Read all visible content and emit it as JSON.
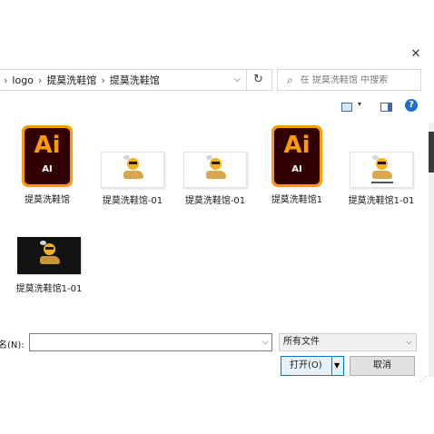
{
  "window": {
    "close_glyph": "✕"
  },
  "address": {
    "crumbs": [
      "logo",
      "提莫洗鞋馆",
      "提莫洗鞋馆"
    ],
    "separator": "›",
    "dropdown_glyph": "⌵",
    "refresh_glyph": "↻"
  },
  "search": {
    "placeholder": "在 提莫洗鞋馆 中搜索",
    "icon": "search-icon"
  },
  "toolbar": {
    "view_icon": "view-icon",
    "pane_icon": "preview-pane-icon",
    "help_glyph": "?"
  },
  "files": [
    {
      "name": "提莫洗鞋馆",
      "kind": "ai",
      "icon_big": "Ai",
      "icon_small": "AI"
    },
    {
      "name": "提莫洗鞋馆-01",
      "kind": "thumb-light"
    },
    {
      "name": "提莫洗鞋馆-01",
      "kind": "thumb-light"
    },
    {
      "name": "提莫洗鞋馆1",
      "kind": "ai",
      "icon_big": "Ai",
      "icon_small": "AI"
    },
    {
      "name": "提莫洗鞋馆1-01",
      "kind": "thumb-light"
    },
    {
      "name": "提莫洗鞋馆1-01",
      "kind": "thumb-dark"
    }
  ],
  "bottom": {
    "filename_label": "名(N):",
    "filename_value": "",
    "filetype_value": "所有文件",
    "open_label": "打开(O)",
    "cancel_label": "取消"
  },
  "colors": {
    "ai_orange": "#fb9b00",
    "ai_dark": "#310000",
    "accent": "#0078d7",
    "help_blue": "#1f6fd1"
  }
}
